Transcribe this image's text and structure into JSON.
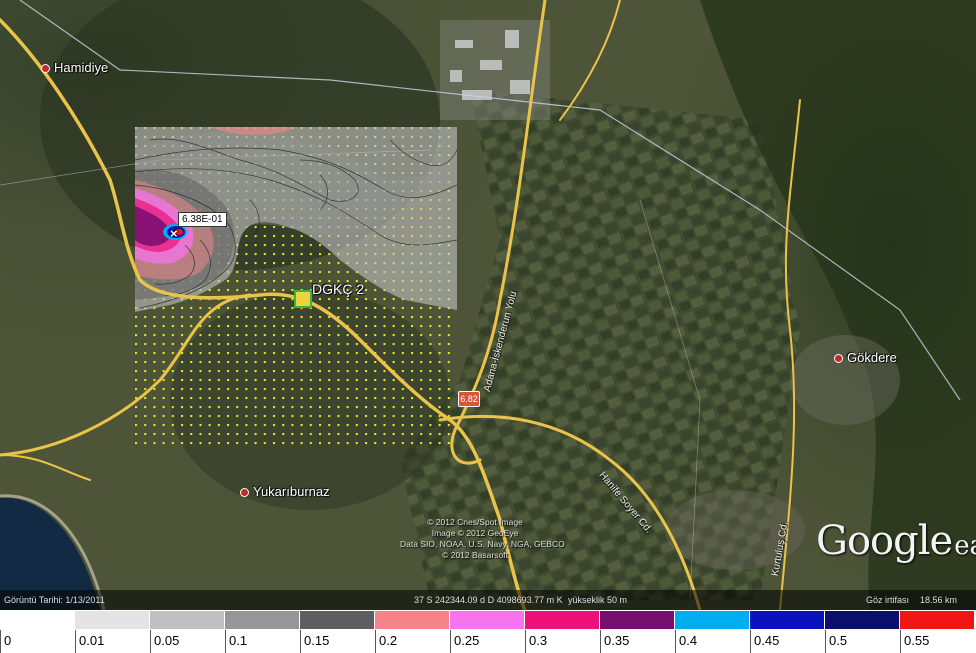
{
  "places": [
    {
      "name": "Hamidiye",
      "icon": "place-dot-icon"
    },
    {
      "name": "Gökdere",
      "icon": "place-dot-icon"
    },
    {
      "name": "Yukarıburnaz",
      "icon": "place-dot-icon"
    }
  ],
  "roads": [
    {
      "name": "Adana-İskenderun Yolu"
    },
    {
      "name": "Hanife Soyer Cd."
    },
    {
      "name": "Kurtuluş Cd."
    }
  ],
  "overlay": {
    "peak_label": "6.38E-01",
    "peak_marker": "×",
    "station_label": "DGKÇ 2",
    "exit_badge": "6.82"
  },
  "credits": [
    "© 2012 Cnes/Spot Image",
    "Image © 2012 GeoEye",
    "Data SIO, NOAA, U.S. Navy, NGA, GEBCO",
    "© 2012 Basarsoft"
  ],
  "logo": {
    "google": "Google",
    "earth": "earth"
  },
  "status_bar": {
    "imagery_date": "Görüntü Tarihi: 1/13/2011",
    "coordinates": "37 S 242344.09 d D 4098693.77 m K",
    "elevation": "yükseklik   50 m",
    "eye_alt_label": "Göz irtifası",
    "eye_alt_value": "18.56 km"
  },
  "legend": {
    "items": [
      {
        "label": "0",
        "color": "#ffffff"
      },
      {
        "label": "0.01",
        "color": "#e4e4e4"
      },
      {
        "label": "0.05",
        "color": "#c0c0c0"
      },
      {
        "label": "0.1",
        "color": "#969696"
      },
      {
        "label": "0.15",
        "color": "#5e5e5e"
      },
      {
        "label": "0.2",
        "color": "#f7838a"
      },
      {
        "label": "0.25",
        "color": "#f774ee"
      },
      {
        "label": "0.3",
        "color": "#ec1279"
      },
      {
        "label": "0.35",
        "color": "#780e6e"
      },
      {
        "label": "0.4",
        "color": "#00aef0"
      },
      {
        "label": "0.45",
        "color": "#0a12bd"
      },
      {
        "label": "0.5",
        "color": "#0c0e6c"
      },
      {
        "label": "0.55",
        "color": "#f11515"
      }
    ]
  },
  "colors": {
    "terrain": "#4b5236",
    "road": "#e9c34a",
    "grid_dot": "#eaea20"
  }
}
